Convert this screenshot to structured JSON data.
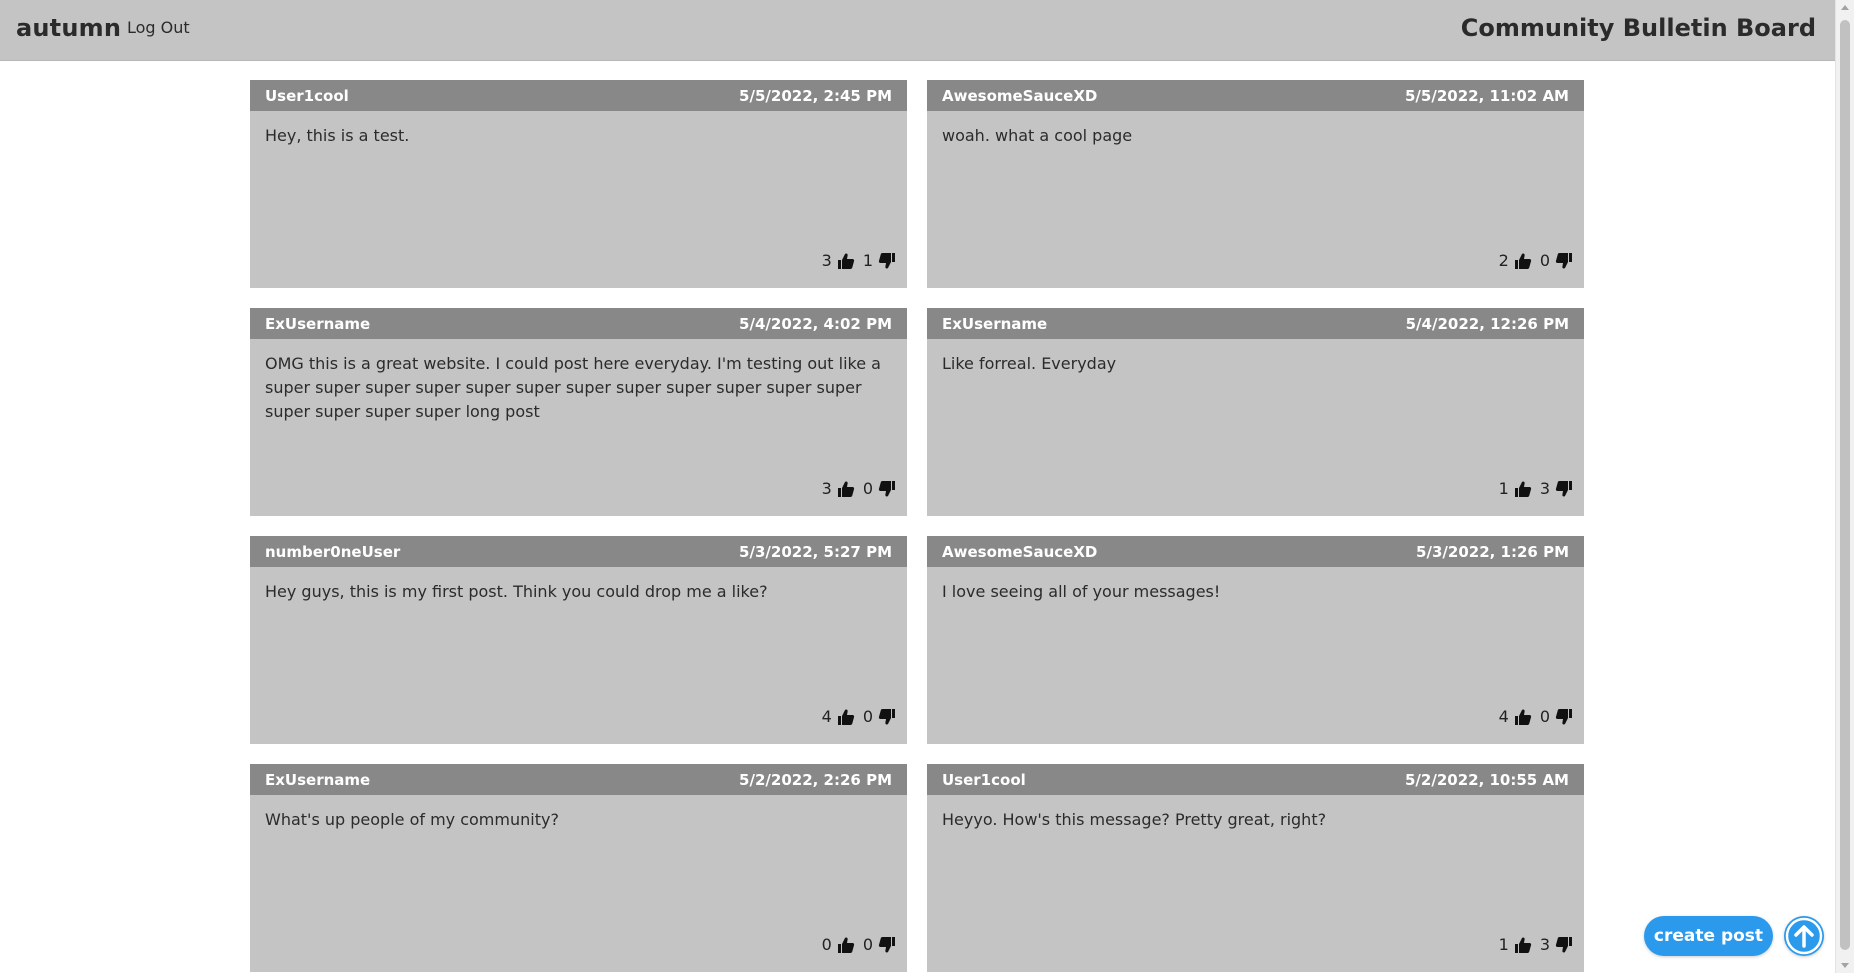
{
  "header": {
    "username": "autumn",
    "logout_label": "Log Out",
    "site_title": "Community Bulletin Board"
  },
  "posts": [
    {
      "user": "User1cool",
      "date": "5/5/2022, 2:45 PM",
      "body": "Hey, this is a test.",
      "likes": "3",
      "dislikes": "1"
    },
    {
      "user": "AwesomeSauceXD",
      "date": "5/5/2022, 11:02 AM",
      "body": "woah. what a cool page",
      "likes": "2",
      "dislikes": "0"
    },
    {
      "user": "ExUsername",
      "date": "5/4/2022, 4:02 PM",
      "body": "OMG this is a great website. I could post here everyday. I'm testing out like a super super super super super super super super super super super super super super super super long post",
      "likes": "3",
      "dislikes": "0"
    },
    {
      "user": "ExUsername",
      "date": "5/4/2022, 12:26 PM",
      "body": "Like forreal. Everyday",
      "likes": "1",
      "dislikes": "3"
    },
    {
      "user": "number0neUser",
      "date": "5/3/2022, 5:27 PM",
      "body": "Hey guys, this is my first post. Think you could drop me a like?",
      "likes": "4",
      "dislikes": "0"
    },
    {
      "user": "AwesomeSauceXD",
      "date": "5/3/2022, 1:26 PM",
      "body": "I love seeing all of your messages!",
      "likes": "4",
      "dislikes": "0"
    },
    {
      "user": "ExUsername",
      "date": "5/2/2022, 2:26 PM",
      "body": "What's up people of my community?",
      "likes": "0",
      "dislikes": "0"
    },
    {
      "user": "User1cool",
      "date": "5/2/2022, 10:55 AM",
      "body": "Heyyo. How's this message? Pretty great, right?",
      "likes": "1",
      "dislikes": "3"
    }
  ],
  "actions": {
    "create_post_label": "create post",
    "scroll_top_icon": "arrow-up-circle-icon"
  },
  "colors": {
    "topbar": "#c4c4c4",
    "post_header": "#888888",
    "post_body": "#c4c4c4",
    "accent": "#2b99ec"
  }
}
